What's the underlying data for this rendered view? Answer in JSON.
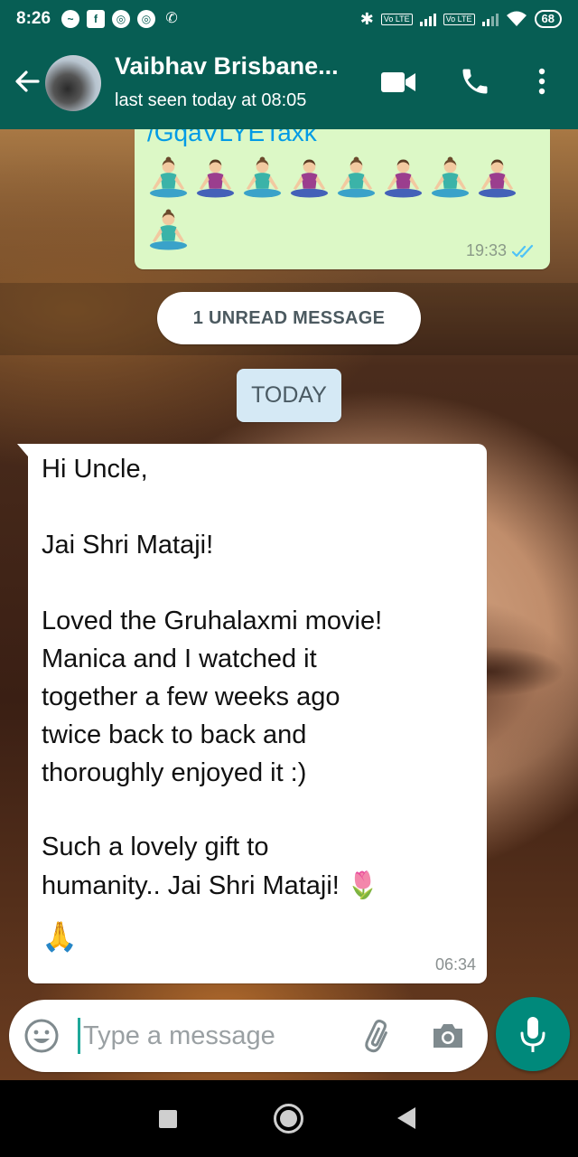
{
  "status_bar": {
    "time": "8:26",
    "battery": "68",
    "network_badge": "Vo LTE"
  },
  "header": {
    "contact_name": "Vaibhav Brisbane...",
    "last_seen": "last seen today at 08:05"
  },
  "messages": {
    "outgoing": {
      "link_fragment": "/GqaVLYETaxk",
      "emoji_row_1_count": 8,
      "emoji_row_2_count": 1,
      "time": "19:33",
      "status": "read"
    },
    "unread_banner": "1 UNREAD MESSAGE",
    "date_chip": "TODAY",
    "incoming": {
      "lines": [
        "Hi Uncle,",
        "Jai Shri Mataji!",
        "Loved the Gruhalaxmi movie!",
        "Manica and I watched it",
        "together a few weeks ago",
        "twice back to back and",
        "thoroughly enjoyed it :)",
        "Such a lovely gift to",
        "humanity.. Jai Shri Mataji! 🌷",
        "🙏"
      ],
      "time": "06:34"
    }
  },
  "composer": {
    "placeholder": "Type a message"
  },
  "colors": {
    "header": "#075e54",
    "outgoing_bubble": "#dcf8c6",
    "incoming_bubble": "#ffffff",
    "accent": "#00897b",
    "read_ticks": "#4fc3f7"
  }
}
